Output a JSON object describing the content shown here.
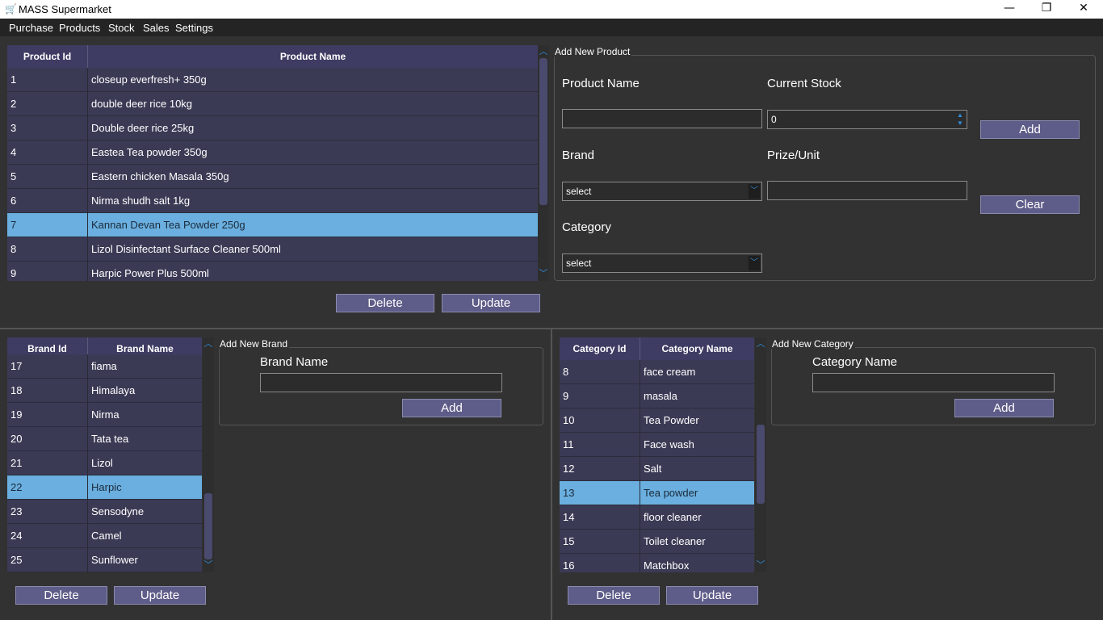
{
  "window": {
    "title": "MASS Supermarket",
    "minimize": "—",
    "restore": "❐",
    "close": "✕",
    "icon": "cart-icon"
  },
  "menu": [
    "Purchase",
    "Products",
    "Stock",
    "Sales",
    "Settings"
  ],
  "products": {
    "headers": [
      "Product Id",
      "Product Name"
    ],
    "rows": [
      {
        "id": "1",
        "name": "closeup everfresh+ 350g"
      },
      {
        "id": "2",
        "name": "double deer rice 10kg"
      },
      {
        "id": "3",
        "name": "Double deer rice 25kg"
      },
      {
        "id": "4",
        "name": "Eastea Tea powder 350g"
      },
      {
        "id": "5",
        "name": "Eastern chicken Masala 350g"
      },
      {
        "id": "6",
        "name": "Nirma shudh salt 1kg"
      },
      {
        "id": "7",
        "name": "Kannan Devan Tea Powder 250g"
      },
      {
        "id": "8",
        "name": "Lizol Disinfectant Surface Cleaner 500ml"
      },
      {
        "id": "9",
        "name": "Harpic Power Plus 500ml"
      }
    ],
    "selected_index": 6,
    "delete_label": "Delete",
    "update_label": "Update"
  },
  "add_product": {
    "group_title": "Add New Product",
    "product_name_label": "Product Name",
    "current_stock_label": "Current Stock",
    "current_stock_value": "0",
    "brand_label": "Brand",
    "brand_value": "select",
    "prize_label": "Prize/Unit",
    "category_label": "Category",
    "category_value": "select",
    "add_label": "Add",
    "clear_label": "Clear"
  },
  "brands": {
    "headers": [
      "Brand Id",
      "Brand Name"
    ],
    "rows": [
      {
        "id": "17",
        "name": "fiama"
      },
      {
        "id": "18",
        "name": "Himalaya"
      },
      {
        "id": "19",
        "name": "Nirma"
      },
      {
        "id": "20",
        "name": "Tata tea"
      },
      {
        "id": "21",
        "name": "Lizol"
      },
      {
        "id": "22",
        "name": "Harpic"
      },
      {
        "id": "23",
        "name": "Sensodyne"
      },
      {
        "id": "24",
        "name": "Camel"
      },
      {
        "id": "25",
        "name": "Sunflower"
      }
    ],
    "selected_index": 5,
    "delete_label": "Delete",
    "update_label": "Update"
  },
  "add_brand": {
    "group_title": "Add New Brand",
    "brand_name_label": "Brand Name",
    "add_label": "Add"
  },
  "categories": {
    "headers": [
      "Category Id",
      "Category Name"
    ],
    "rows": [
      {
        "id": "8",
        "name": "face cream"
      },
      {
        "id": "9",
        "name": "masala"
      },
      {
        "id": "10",
        "name": "Tea Powder"
      },
      {
        "id": "11",
        "name": "Face wash"
      },
      {
        "id": "12",
        "name": "Salt"
      },
      {
        "id": "13",
        "name": "Tea powder"
      },
      {
        "id": "14",
        "name": " floor cleaner"
      },
      {
        "id": "15",
        "name": "Toilet cleaner"
      },
      {
        "id": "16",
        "name": "Matchbox"
      }
    ],
    "selected_index": 5,
    "delete_label": "Delete",
    "update_label": "Update"
  },
  "add_category": {
    "group_title": "Add New Category",
    "category_name_label": "Category Name",
    "add_label": "Add"
  },
  "colors": {
    "row_bg": "#3b3a55",
    "row_selected": "#6aafdf",
    "header_bg": "#3e3c63",
    "button_bg": "#5e5c88",
    "scroll_arrow": "#2f8cdc"
  }
}
